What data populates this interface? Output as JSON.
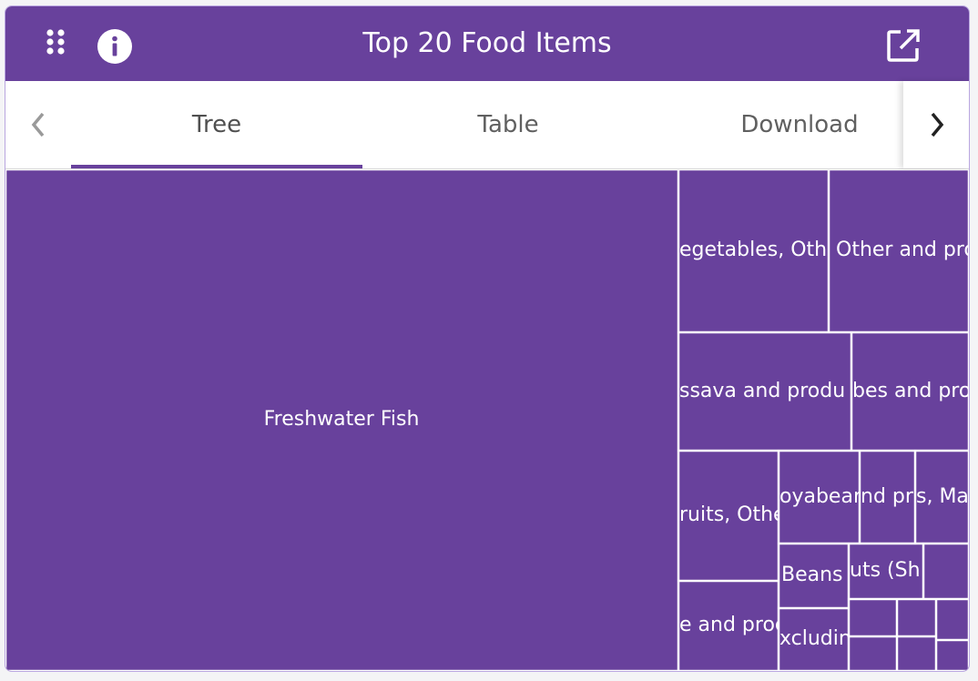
{
  "header": {
    "title": "Top 20 Food Items",
    "apps_icon": "apps-grid-icon",
    "info_icon": "info-icon",
    "external_icon": "open-external-icon"
  },
  "tabs": [
    {
      "label": "Tree",
      "active": true
    },
    {
      "label": "Table",
      "active": false
    },
    {
      "label": "Download",
      "active": false
    }
  ],
  "nav": {
    "prev_icon": "chevron-left-icon",
    "next_icon": "chevron-right-icon"
  },
  "colors": {
    "accent": "#68419c",
    "cell_border": "#ffffff",
    "label": "#ffffff"
  },
  "chart_data": {
    "type": "treemap",
    "title": "Top 20 Food Items",
    "items": [
      {
        "label": "Freshwater Fish"
      },
      {
        "label": "egetables, Othe"
      },
      {
        "label": "Other and pro"
      },
      {
        "label": "ssava and produ"
      },
      {
        "label": "bes and pro"
      },
      {
        "label": "ruits, Othe"
      },
      {
        "label": "oyabear"
      },
      {
        "label": "nd pr"
      },
      {
        "label": "s, Mar"
      },
      {
        "label": "Beans"
      },
      {
        "label": "uts (Sh"
      },
      {
        "label": "e and proc"
      },
      {
        "label": "xcluding"
      },
      {
        "label": ""
      },
      {
        "label": ""
      },
      {
        "label": ""
      },
      {
        "label": ""
      },
      {
        "label": ""
      },
      {
        "label": ""
      },
      {
        "label": ""
      }
    ]
  }
}
